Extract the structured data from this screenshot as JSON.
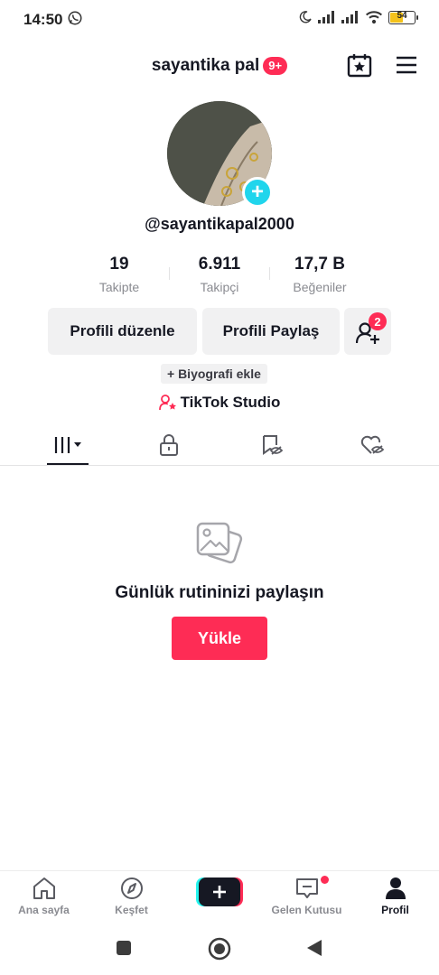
{
  "status_bar": {
    "time": "14:50",
    "battery": "54",
    "icons": [
      "whatsapp-icon",
      "moon-icon",
      "signal-icon",
      "signal-icon",
      "wifi-icon",
      "battery-icon"
    ]
  },
  "header": {
    "title": "sayantika pal",
    "notification_badge": "9+",
    "icons": [
      "calendar-star-icon",
      "menu-icon"
    ]
  },
  "profile": {
    "handle": "@sayantikapal2000",
    "stats": [
      {
        "value": "19",
        "label": "Takipte"
      },
      {
        "value": "6.911",
        "label": "Takipçi"
      },
      {
        "value": "17,7 B",
        "label": "Beğeniler"
      }
    ],
    "edit_button": "Profili düzenle",
    "share_button": "Profili Paylaş",
    "add_friend_badge": "2",
    "bio_button": "+ Biyografi ekle",
    "studio_link": "TikTok Studio"
  },
  "tabs": {
    "icons": [
      "grid-icon",
      "lock-icon",
      "repost-icon",
      "liked-icon"
    ],
    "active": 0
  },
  "empty_state": {
    "title": "Günlük rutininizi paylaşın",
    "upload_button": "Yükle"
  },
  "bottom_nav": {
    "items": [
      {
        "label": "Ana sayfa",
        "icon": "home-icon"
      },
      {
        "label": "Keşfet",
        "icon": "compass-icon"
      },
      {
        "label": "",
        "icon": "create-icon"
      },
      {
        "label": "Gelen Kutusu",
        "icon": "inbox-icon"
      },
      {
        "label": "Profil",
        "icon": "profile-icon"
      }
    ],
    "active": 4
  },
  "colors": {
    "accent": "#fe2c55",
    "cyan": "#20d5ec",
    "text": "#161823",
    "muted": "#8a8b91"
  }
}
